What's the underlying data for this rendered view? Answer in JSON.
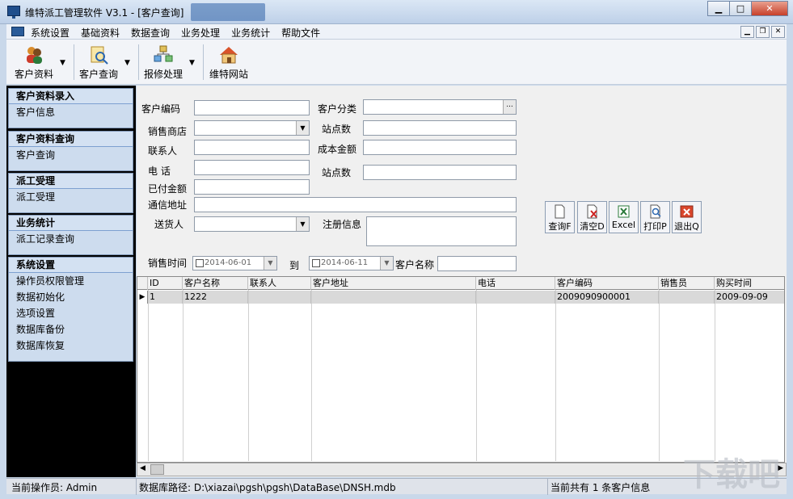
{
  "window": {
    "title": "维特派工管理软件 V3.1 - [客户查询]",
    "min_label": "▁",
    "max_label": "□",
    "close_label": "✕"
  },
  "menu": {
    "items": [
      "系统设置",
      "基础资料",
      "数据查询",
      "业务处理",
      "业务统计",
      "帮助文件"
    ]
  },
  "toolbar": {
    "buttons": [
      {
        "label": "客户资料",
        "icon": "users-icon"
      },
      {
        "label": "客户查询",
        "icon": "search-doc-icon"
      },
      {
        "label": "报修处理",
        "icon": "repair-icon"
      },
      {
        "label": "维特网站",
        "icon": "home-icon"
      }
    ]
  },
  "sidebar": {
    "groups": [
      {
        "title": "客户资料录入",
        "items": [
          "客户信息"
        ]
      },
      {
        "title": "客户资料查询",
        "items": [
          "客户查询"
        ]
      },
      {
        "title": "派工受理",
        "items": [
          "派工受理"
        ]
      },
      {
        "title": "业务统计",
        "items": [
          "派工记录查询"
        ]
      },
      {
        "title": "系统设置",
        "items": [
          "操作员权限管理",
          "数据初始化",
          "选项设置",
          "数据库备份",
          "数据库恢复"
        ]
      }
    ]
  },
  "form": {
    "customer_code": "客户编码",
    "customer_category": "客户分类",
    "sales_shop": "销售商店",
    "site_count": "站点数",
    "contact": "联系人",
    "cost_amount": "成本金额",
    "phone": "电 话",
    "site_count2": "站点数",
    "paid_amount": "已付金额",
    "address": "通信地址",
    "delivery": "送货人",
    "register_info": "注册信息",
    "sale_time": "销售时间",
    "date_from": "2014-06-01",
    "to": "到",
    "date_to": "2014-06-11",
    "customer_name": "客户名称"
  },
  "actions": {
    "query": "查询F",
    "clear": "清空D",
    "excel": "Excel",
    "print": "打印P",
    "exit": "退出Q"
  },
  "grid": {
    "columns": [
      "ID",
      "客户名称",
      "联系人",
      "客户地址",
      "电话",
      "客户编码",
      "销售员",
      "购买时间"
    ],
    "rows": [
      [
        "1",
        "1222",
        "",
        "",
        "",
        "2009090900001",
        "",
        "2009-09-09"
      ]
    ]
  },
  "status": {
    "operator": "当前操作员: Admin",
    "db_path": "数据库路径: D:\\xiazai\\pgsh\\pgsh\\DataBase\\DNSH.mdb",
    "count": "当前共有 1 条客户信息"
  },
  "watermark": "下载吧",
  "colors": {
    "sidebar_bg": "#000000",
    "group_bg": "#cddcee",
    "title_bg": "#bed0e8",
    "close_btn": "#c7402a"
  }
}
